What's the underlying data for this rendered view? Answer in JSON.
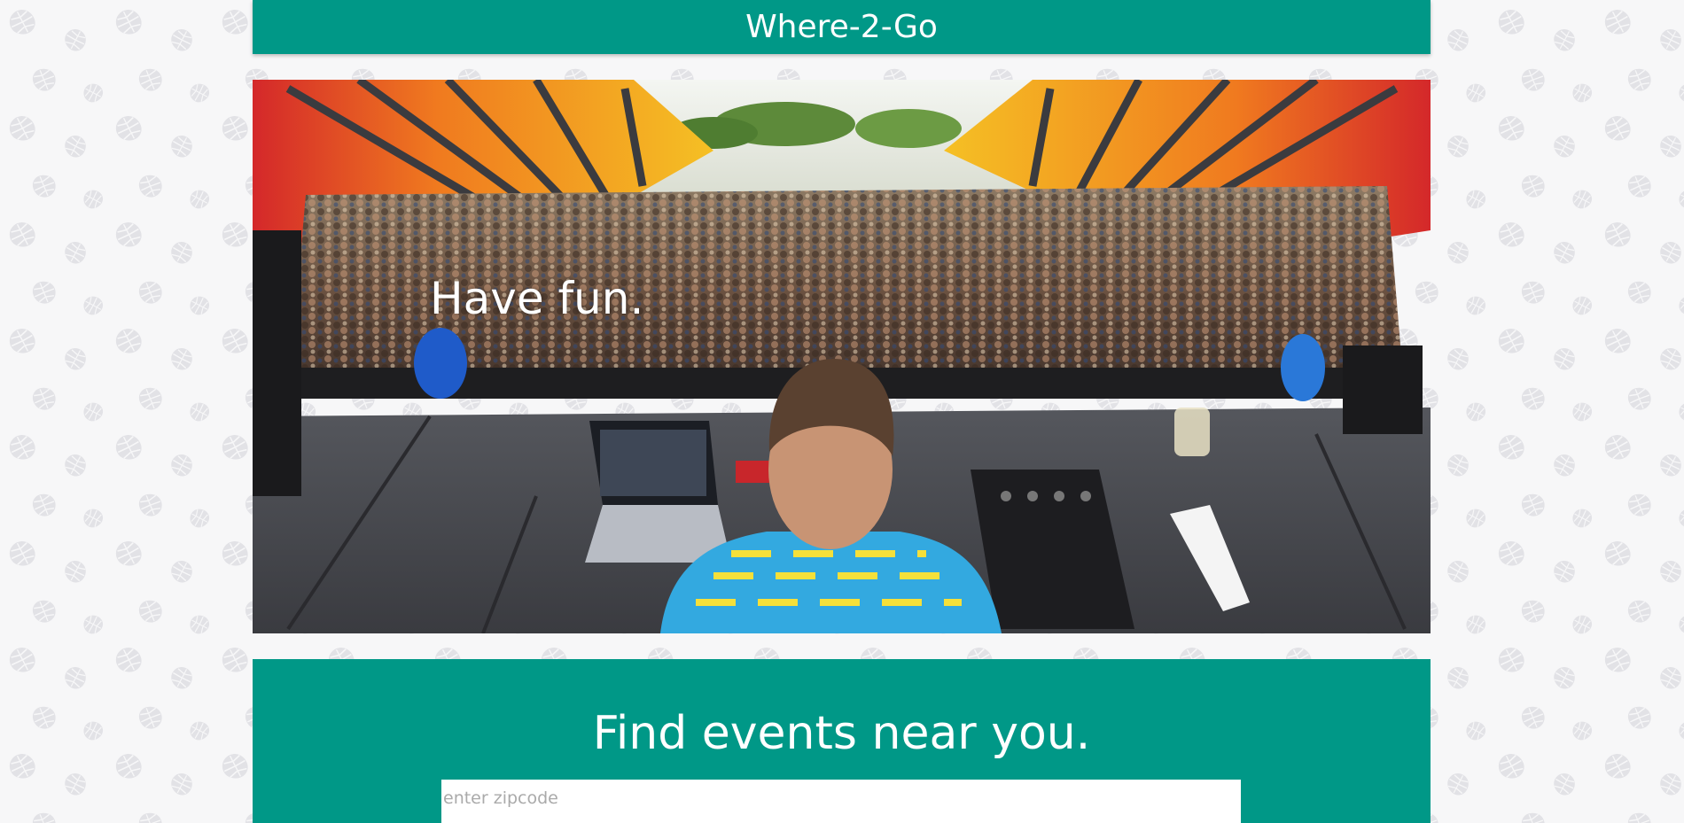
{
  "app": {
    "title": "Where-2-Go"
  },
  "hero": {
    "tagline": "Have fun."
  },
  "search": {
    "heading": "Find events near you.",
    "zip_placeholder": "enter zipcode",
    "zip_value": ""
  },
  "colors": {
    "brand": "#009887",
    "background": "#f7f7f8",
    "pattern": "#e3e3e6"
  },
  "icons": {
    "background_pattern": "monstera-leaf-icon"
  }
}
